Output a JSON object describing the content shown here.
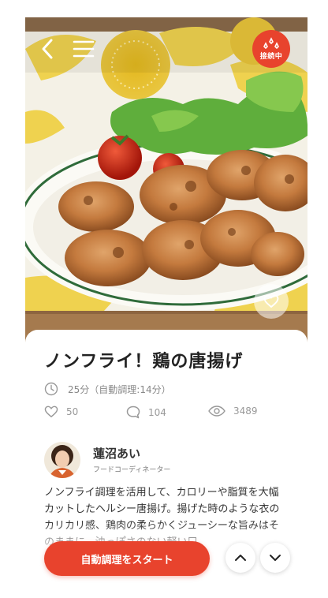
{
  "header": {
    "back_icon": "chevron-left-icon",
    "menu_icon": "hamburger-icon",
    "connection_label": "接続中",
    "connection_color": "#e8432d"
  },
  "recipe": {
    "title": "ノンフライ！鶏の唐揚げ",
    "time": "25分（自動調理:14分）",
    "likes": "50",
    "comments": "104",
    "views": "3489"
  },
  "author": {
    "name": "蓮沼あい",
    "role": "フードコーディネーター"
  },
  "description": "ノンフライ調理を活用して、カロリーや脂質を大幅カットしたヘルシー唐揚げ。揚げた時のような衣のカリカリ感、鶏肉の柔らかくジューシーな旨みはそのままに、油っぽさのない軽い口",
  "actions": {
    "start_label": "自動調理をスタート"
  },
  "colors": {
    "accent": "#e8432d",
    "text": "#222222",
    "muted": "#999999"
  }
}
